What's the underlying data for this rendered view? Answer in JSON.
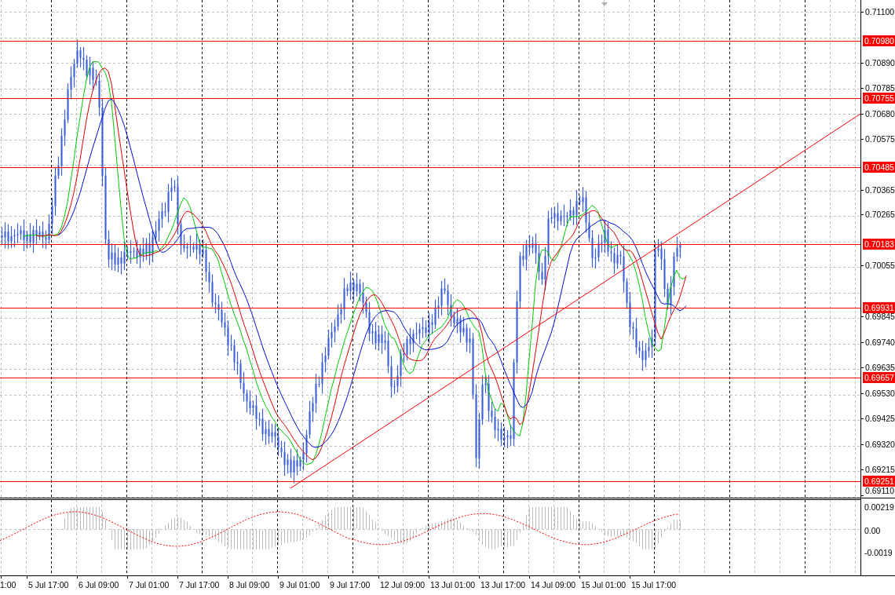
{
  "price_axis": {
    "ticks": [
      "0.71100",
      "0.70890",
      "0.70785",
      "0.70680",
      "0.70575",
      "0.70365",
      "0.70265",
      "0.70055",
      "0.69845",
      "0.69740",
      "0.69635",
      "0.69530",
      "0.69425",
      "0.69320",
      "0.69215",
      "0.69110"
    ]
  },
  "price_levels": [
    {
      "price": "0.70980"
    },
    {
      "price": "0.70755"
    },
    {
      "price": "0.70485"
    },
    {
      "price": "0.70183"
    },
    {
      "price": "0.69931"
    },
    {
      "price": "0.69657"
    },
    {
      "price": "0.69251"
    }
  ],
  "indicator_axis": {
    "ticks": [
      "0.00219",
      "0.00",
      "-0.0019"
    ]
  },
  "time_axis": {
    "labels": [
      "1:00",
      "5 Jul 17:00",
      "6 Jul 09:00",
      "7 Jul 01:00",
      "7 Jul 17:00",
      "8 Jul 09:00",
      "9 Jul 01:00",
      "9 Jul 17:00",
      "12 Jul 09:00",
      "13 Jul 01:00",
      "13 Jul 17:00",
      "14 Jul 09:00",
      "15 Jul 01:00",
      "15 Jul 17:00"
    ]
  }
}
